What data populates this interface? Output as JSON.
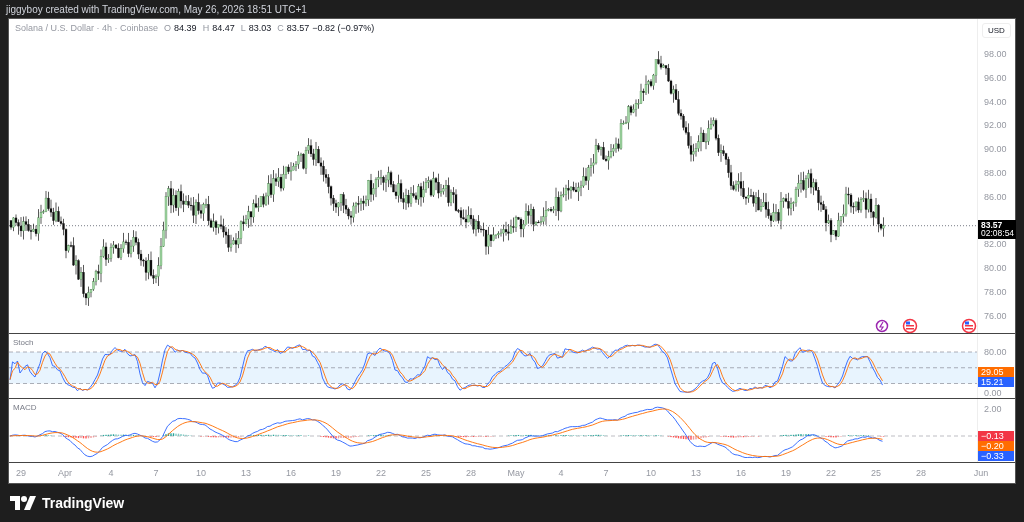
{
  "attribution": "jiggyboy created with TradingView.com, May 26, 2026 18:51 UTC+1",
  "legend": {
    "symbol": "Solana / U.S. Dollar · 4h · Coinbase",
    "ohlc": [
      {
        "label": "O",
        "value": "84.39"
      },
      {
        "label": "H",
        "value": "84.47"
      },
      {
        "label": "L",
        "value": "83.03"
      },
      {
        "label": "C",
        "value": "83.57"
      }
    ],
    "change": "−0.82 (−0.97%)"
  },
  "currency": "USD",
  "price_axis": [
    "98.00",
    "96.00",
    "94.00",
    "92.00",
    "90.00",
    "88.00",
    "86.00",
    "82.00",
    "80.00",
    "78.00",
    "76.00"
  ],
  "last_price": {
    "price": "83.57",
    "countdown": "02:08:54"
  },
  "stoch": {
    "title": "Stoch",
    "axis": [
      "80.00",
      "0.00"
    ],
    "values": [
      {
        "text": "29.05",
        "color": "#ff6d00"
      },
      {
        "text": "15.21",
        "color": "#2962ff"
      }
    ]
  },
  "macd": {
    "title": "MACD",
    "axis": [
      "2.00"
    ],
    "values": [
      {
        "text": "−0.13",
        "color": "#f23645"
      },
      {
        "text": "−0.20",
        "color": "#ff6d00"
      },
      {
        "text": "−0.33",
        "color": "#2962ff"
      }
    ]
  },
  "time_axis": [
    "29",
    "Apr",
    "4",
    "7",
    "10",
    "13",
    "16",
    "19",
    "22",
    "25",
    "28",
    "May",
    "4",
    "7",
    "10",
    "13",
    "16",
    "19",
    "22",
    "25",
    "28",
    "Jun"
  ],
  "footer": {
    "brand": "TradingView"
  }
}
